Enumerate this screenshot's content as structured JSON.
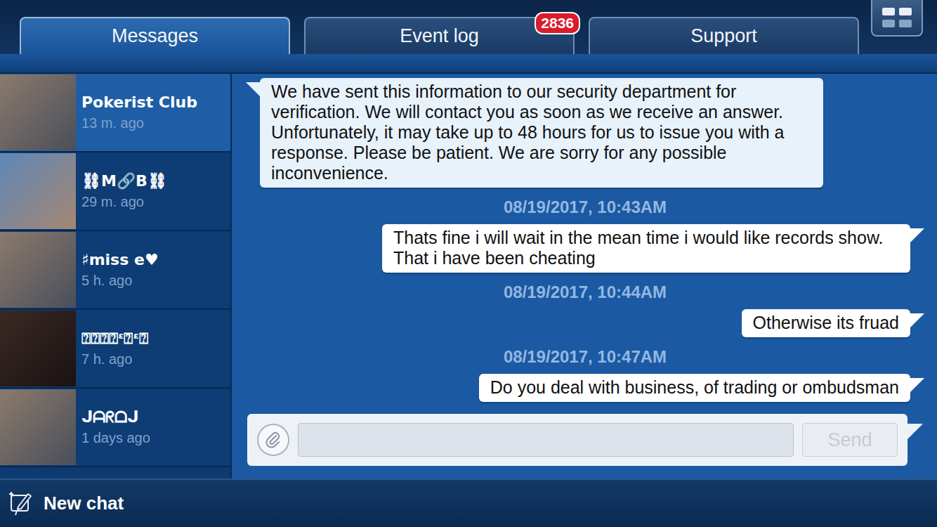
{
  "tabs": [
    {
      "label": "Messages",
      "selected": true,
      "badge": null
    },
    {
      "label": "Event log",
      "selected": false,
      "badge": "2836"
    },
    {
      "label": "Support",
      "selected": false,
      "badge": null
    }
  ],
  "contacts": [
    {
      "name": "Pokerist Club",
      "time": "13 m. ago",
      "selected": true
    },
    {
      "name": "⛓M🔗B⛓",
      "time": "29 m. ago",
      "selected": false
    },
    {
      "name": "♯miss e♥",
      "time": "5 h. ago",
      "selected": false
    },
    {
      "name": "⍰⍰⍰⍰ᵋ⍰ᵋ⍰",
      "time": "7 h. ago",
      "selected": false
    },
    {
      "name": "ᒍᗩᖇᗝᒍ",
      "time": "1 days ago",
      "selected": false
    }
  ],
  "messages": [
    {
      "kind": "incoming",
      "text": "We have sent this information to our security department for verification. We will contact you as soon as we receive an answer. Unfortunately, it may take up to 48 hours for us to issue you with a response. Please be patient. We are sorry for any possible inconvenience."
    },
    {
      "kind": "timestamp",
      "text": "08/19/2017, 10:43AM"
    },
    {
      "kind": "outgoing",
      "text": "Thats fine i will wait in the mean time i would like records show. That i have been cheating"
    },
    {
      "kind": "timestamp",
      "text": "08/19/2017, 10:44AM"
    },
    {
      "kind": "outgoing",
      "text": "Otherwise its fruad"
    },
    {
      "kind": "timestamp",
      "text": "08/19/2017, 10:47AM"
    },
    {
      "kind": "outgoing",
      "text": "Do you deal with business, of trading or ombudsman"
    }
  ],
  "composer": {
    "placeholder": "",
    "send_button": {
      "label": "Send",
      "disabled": true
    }
  },
  "new_chat": {
    "label": "New chat"
  }
}
